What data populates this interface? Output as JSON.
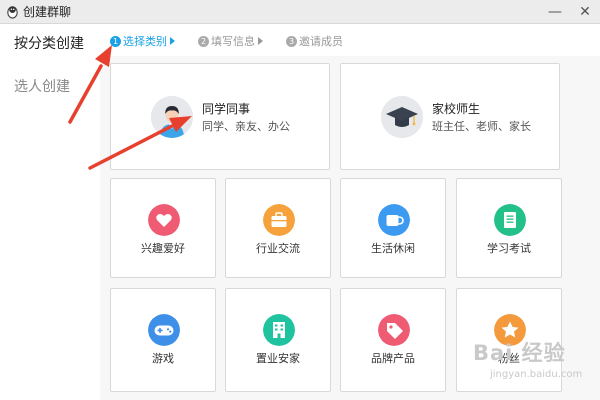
{
  "window": {
    "title": "创建群聊",
    "minimize_glyph": "—",
    "close_glyph": "✕"
  },
  "sidebar": {
    "items": [
      {
        "label": "按分类创建",
        "active": true
      },
      {
        "label": "选人创建",
        "active": false
      }
    ]
  },
  "steps": [
    {
      "num": "1",
      "label": "选择类别",
      "active": true
    },
    {
      "num": "2",
      "label": "填写信息",
      "active": false
    },
    {
      "num": "3",
      "label": "邀请成员",
      "active": false
    }
  ],
  "featured_categories": [
    {
      "title": "同学同事",
      "subtitle": "同学、亲友、办公",
      "icon": "person-avatar-icon"
    },
    {
      "title": "家校师生",
      "subtitle": "班主任、老师、家长",
      "icon": "graduation-cap-icon"
    }
  ],
  "categories": [
    {
      "label": "兴趣爱好",
      "icon": "heart-icon",
      "color": "#ef5b72"
    },
    {
      "label": "行业交流",
      "icon": "briefcase-icon",
      "color": "#f5a23c"
    },
    {
      "label": "生活休闲",
      "icon": "coffee-cup-icon",
      "color": "#3d9af1"
    },
    {
      "label": "学习考试",
      "icon": "document-icon",
      "color": "#23c08a"
    },
    {
      "label": "游戏",
      "icon": "gamepad-icon",
      "color": "#3d8fe8"
    },
    {
      "label": "置业安家",
      "icon": "building-icon",
      "color": "#1fc39f"
    },
    {
      "label": "品牌产品",
      "icon": "tag-icon",
      "color": "#ef5b72"
    },
    {
      "label": "粉丝",
      "icon": "star-icon",
      "color": "#f59a3c"
    }
  ],
  "colors": {
    "accent": "#1aa1e6",
    "annotation_arrow": "#e8402f"
  },
  "watermark": {
    "text": "Bai 经验",
    "url": "jingyan.baidu.com"
  }
}
